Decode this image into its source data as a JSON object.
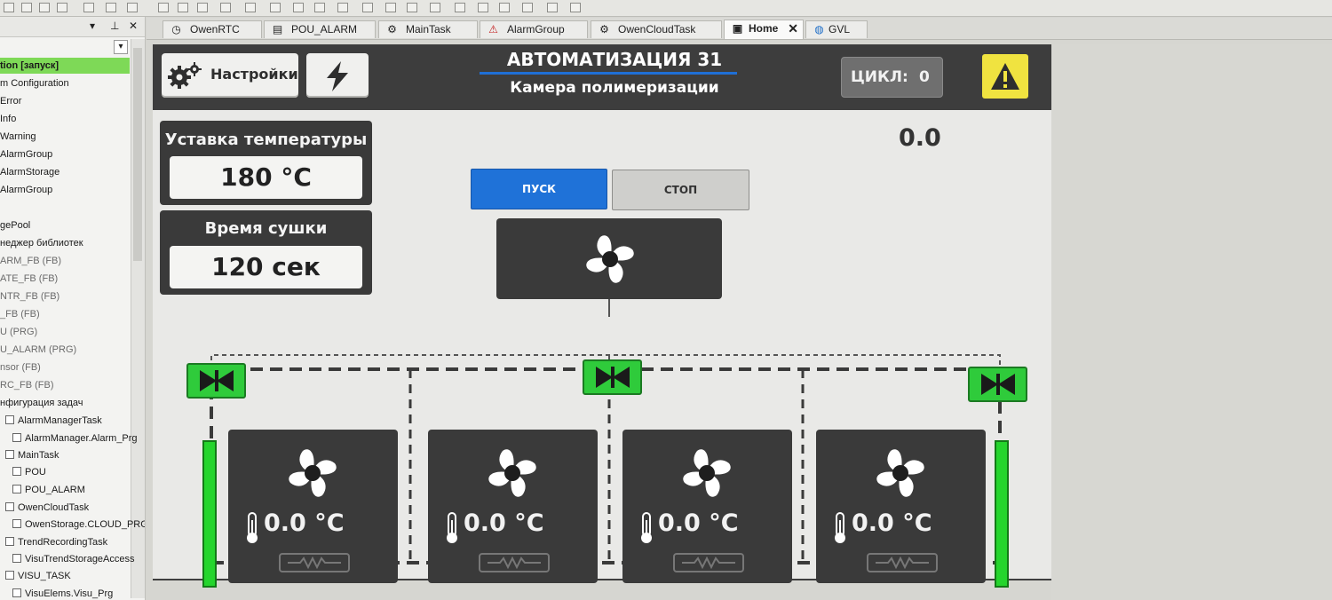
{
  "tree": {
    "items": [
      {
        "label": "tion [запуск]",
        "selected": true
      },
      {
        "label": "m Configuration"
      },
      {
        "label": "Error"
      },
      {
        "label": "Info"
      },
      {
        "label": "Warning"
      },
      {
        "label": "AlarmGroup"
      },
      {
        "label": "AlarmStorage"
      },
      {
        "label": "AlarmGroup"
      },
      {
        "label": "gePool"
      },
      {
        "label": "неджер библиотек"
      },
      {
        "label": "ARM_FB (FB)"
      },
      {
        "label": "ATE_FB (FB)"
      },
      {
        "label": "NTR_FB (FB)"
      },
      {
        "label": "_FB (FB)"
      },
      {
        "label": "U (PRG)"
      },
      {
        "label": "U_ALARM (PRG)"
      },
      {
        "label": "nsor (FB)"
      },
      {
        "label": "RC_FB (FB)"
      },
      {
        "label": "нфигурация задач"
      },
      {
        "label": "AlarmManagerTask"
      },
      {
        "label": "AlarmManager.Alarm_Prg"
      },
      {
        "label": "MainTask"
      },
      {
        "label": "POU"
      },
      {
        "label": "POU_ALARM"
      },
      {
        "label": "OwenCloudTask"
      },
      {
        "label": "OwenStorage.CLOUD_PRG"
      },
      {
        "label": "TrendRecordingTask"
      },
      {
        "label": "VisuTrendStorageAccess"
      },
      {
        "label": "VISU_TASK"
      },
      {
        "label": "VisuElems.Visu_Prg"
      }
    ]
  },
  "tabs": [
    {
      "label": "OwenRTC",
      "icon": "clock-icon"
    },
    {
      "label": "POU_ALARM",
      "icon": "document-icon"
    },
    {
      "label": "MainTask",
      "icon": "task-icon"
    },
    {
      "label": "AlarmGroup",
      "icon": "alarm-triangle-icon"
    },
    {
      "label": "OwenCloudTask",
      "icon": "task-icon"
    },
    {
      "label": "Home",
      "icon": "visu-page-icon",
      "active": true,
      "close": "✕"
    },
    {
      "label": "GVL",
      "icon": "globe-icon"
    }
  ],
  "visu": {
    "settings_label": "Настройки",
    "title": "АВТОМАТИЗАЦИЯ 31",
    "subtitle": "Камера полимеризации",
    "cycle_label": "ЦИКЛ:",
    "cycle_value": "0",
    "setpoint_title": "Уставка температуры",
    "setpoint_value": "180 °C",
    "dry_title": "Время сушки",
    "dry_value": "120 сек",
    "readout": "0.0",
    "start_label": "ПУСК",
    "stop_label": "СТОП",
    "zones": [
      {
        "temp": "0.0 °C"
      },
      {
        "temp": "0.0 °C"
      },
      {
        "temp": "0.0 °C"
      },
      {
        "temp": "0.0 °C"
      }
    ]
  },
  "colors": {
    "start_button": "#1f72d8",
    "valve_green": "#2fcb3b",
    "alarm_yellow": "#f0e340",
    "panel_dark": "#3a3a3a"
  }
}
